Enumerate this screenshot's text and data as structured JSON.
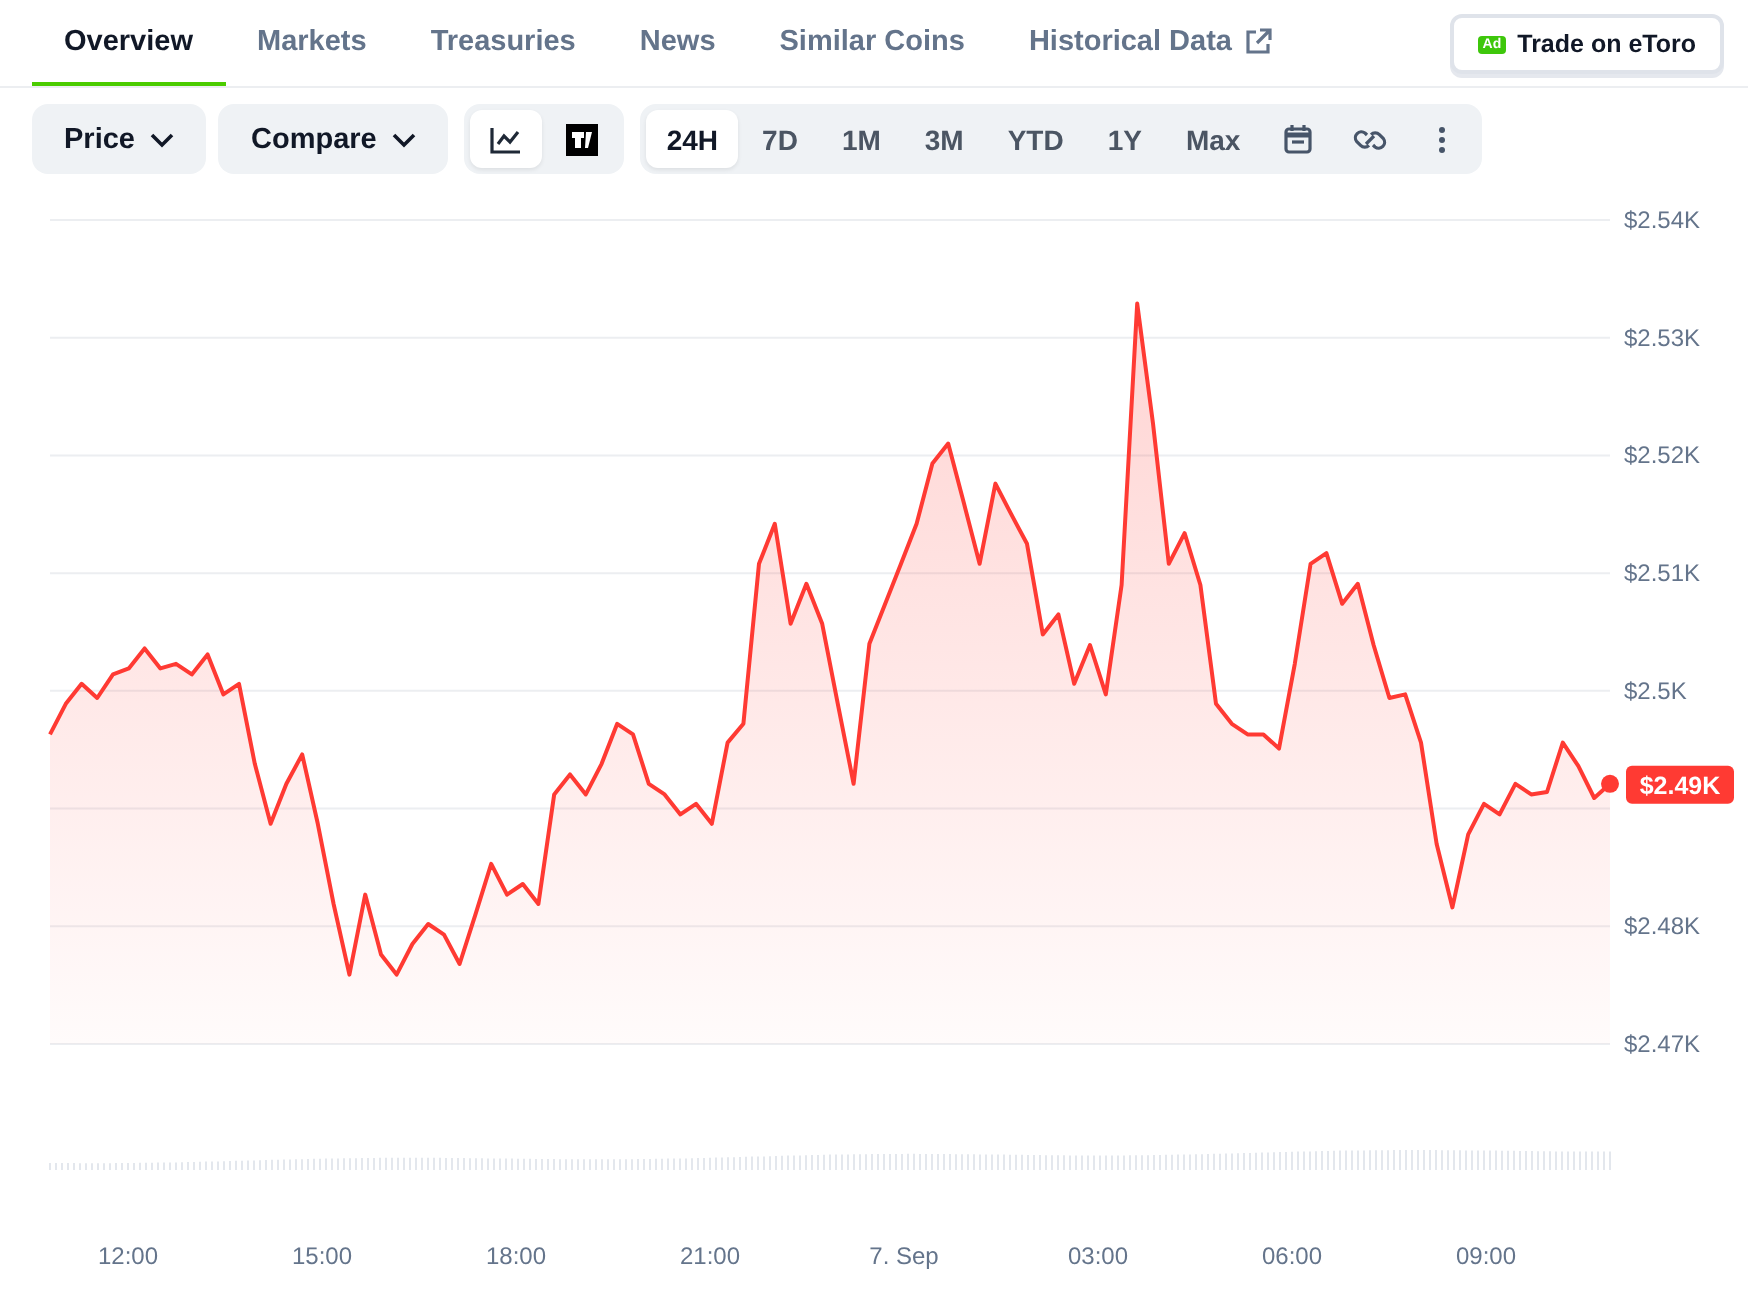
{
  "tabs": [
    {
      "label": "Overview",
      "selected": true,
      "external": false
    },
    {
      "label": "Markets",
      "selected": false,
      "external": false
    },
    {
      "label": "Treasuries",
      "selected": false,
      "external": false
    },
    {
      "label": "News",
      "selected": false,
      "external": false
    },
    {
      "label": "Similar Coins",
      "selected": false,
      "external": false
    },
    {
      "label": "Historical Data",
      "selected": false,
      "external": true
    }
  ],
  "ad_button": {
    "badge": "Ad",
    "label": "Trade on eToro"
  },
  "dropdowns": [
    {
      "label": "Price"
    },
    {
      "label": "Compare"
    }
  ],
  "chart_types": [
    {
      "kind": "line",
      "selected": true
    },
    {
      "kind": "tradingview",
      "selected": false
    }
  ],
  "ranges": [
    {
      "label": "24H",
      "selected": true
    },
    {
      "label": "7D",
      "selected": false
    },
    {
      "label": "1M",
      "selected": false
    },
    {
      "label": "3M",
      "selected": false
    },
    {
      "label": "YTD",
      "selected": false
    },
    {
      "label": "1Y",
      "selected": false
    },
    {
      "label": "Max",
      "selected": false
    }
  ],
  "tools": [
    {
      "kind": "calendar"
    },
    {
      "kind": "link"
    },
    {
      "kind": "more"
    }
  ],
  "price_tag": "$2.49K",
  "time_axis_labels": [
    "12:00",
    "15:00",
    "18:00",
    "21:00",
    "7. Sep",
    "03:00",
    "06:00",
    "09:00"
  ],
  "chart_data": {
    "type": "area",
    "grid": true,
    "ylim": [
      2470,
      2540
    ],
    "yticks": [
      {
        "value": 2470,
        "label": "$2.47K"
      },
      {
        "value": 2480,
        "label": "$2.48K"
      },
      {
        "value": 2500,
        "label": "$2.5K"
      },
      {
        "value": 2510,
        "label": "$2.51K"
      },
      {
        "value": 2520,
        "label": "$2.52K"
      },
      {
        "value": 2530,
        "label": "$2.53K"
      },
      {
        "value": 2540,
        "label": "$2.54K"
      }
    ],
    "series": [
      {
        "color": "#ff3a33",
        "values": [
          2496.3,
          2498.9,
          2500.6,
          2499.4,
          2501.4,
          2501.9,
          2503.6,
          2501.9,
          2502.3,
          2501.4,
          2503.1,
          2499.7,
          2500.6,
          2493.8,
          2488.7,
          2492.1,
          2494.6,
          2488.7,
          2481.9,
          2475.9,
          2482.7,
          2477.6,
          2475.9,
          2478.5,
          2480.2,
          2479.3,
          2476.8,
          2481.0,
          2485.3,
          2482.7,
          2483.6,
          2481.9,
          2491.2,
          2492.9,
          2491.2,
          2493.8,
          2497.2,
          2496.3,
          2492.1,
          2491.2,
          2489.5,
          2490.4,
          2488.7,
          2495.6,
          2497.2,
          2510.8,
          2514.2,
          2505.7,
          2509.1,
          2505.7,
          2498.9,
          2492.1,
          2504.0,
          2507.4,
          2510.8,
          2514.2,
          2519.3,
          2521.0,
          2515.9,
          2510.8,
          2517.6,
          2515.0,
          2512.5,
          2504.8,
          2506.5,
          2500.6,
          2503.9,
          2499.7,
          2509.0,
          2532.9,
          2522.7,
          2510.8,
          2513.4,
          2509.0,
          2498.9,
          2497.2,
          2496.3,
          2496.3,
          2495.1,
          2502.3,
          2510.8,
          2511.7,
          2507.4,
          2509.1,
          2503.9,
          2499.4,
          2499.7,
          2495.6,
          2487.0,
          2481.6,
          2487.8,
          2490.4,
          2489.5,
          2492.1,
          2491.2,
          2491.4,
          2495.6,
          2493.6,
          2490.9,
          2492.1
        ]
      }
    ]
  }
}
